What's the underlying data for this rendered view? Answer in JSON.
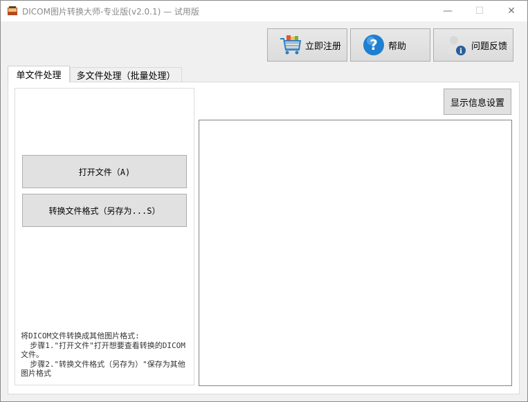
{
  "window": {
    "title": "DICOM图片转换大师-专业版(v2.0.1) — 试用版"
  },
  "window_controls": {
    "minimize": "—",
    "maximize": "☐",
    "close": "✕"
  },
  "toolbar": {
    "register": {
      "label": "立即注册",
      "icon": "shopping-cart-icon"
    },
    "help": {
      "label": "帮助",
      "icon": "question-icon"
    },
    "feedback": {
      "label": "问题反馈",
      "icon": "user-info-icon"
    }
  },
  "tabs": [
    {
      "label": "单文件处理",
      "active": true
    },
    {
      "label": "多文件处理（批量处理）",
      "active": false
    }
  ],
  "single": {
    "open_button": "打开文件（A)",
    "convert_button": "转换文件格式（另存为...S）",
    "info_lines": [
      "将DICOM文件转换成其他图片格式:",
      "  步骤1.\"打开文件\"打开想要查看转换的DICOM文件。",
      "  步骤2.\"转换文件格式（另存为）\"保存为其他图片格式"
    ],
    "display_settings_button": "显示信息设置"
  }
}
